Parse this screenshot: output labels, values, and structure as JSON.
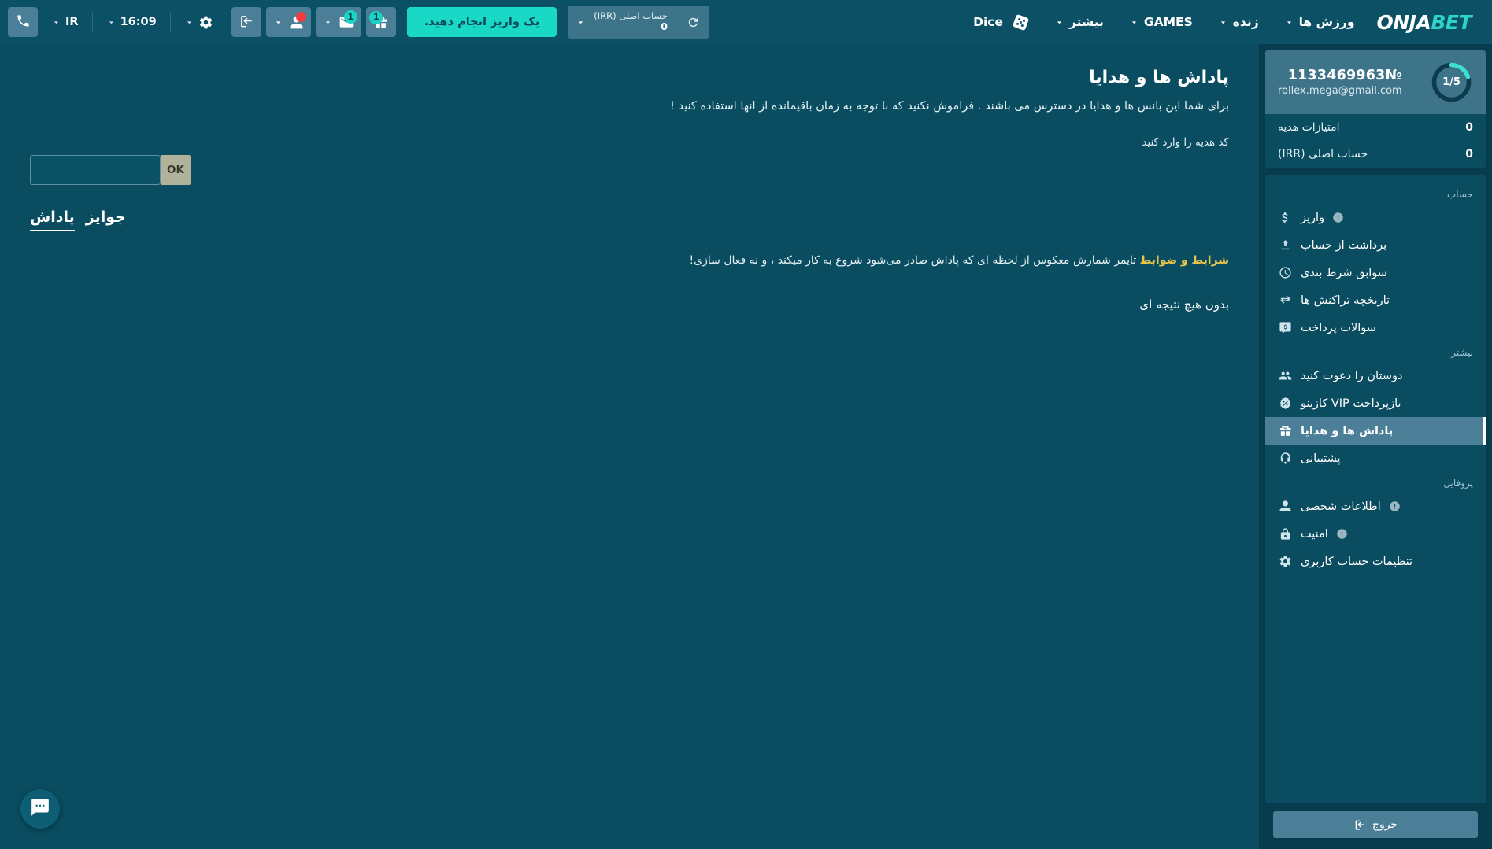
{
  "topbar": {
    "phone_icon": "phone-icon",
    "country": "IR",
    "time": "16:09",
    "settings_icon": "gear-icon",
    "login_icon": "login-arrow-icon",
    "profile_icon": "user-icon",
    "profile_badge": "",
    "mail_icon": "envelope-icon",
    "mail_badge": "1",
    "gift_icon": "gift-icon",
    "gift_badge": "1",
    "deposit_label": "یک واریز انجام دهید.",
    "balance_name": "حساب اصلی (IRR)",
    "balance_amount": "0",
    "refresh_icon": "refresh-icon",
    "dice_label": "Dice",
    "dice_icon": "dice-icon",
    "nav": [
      {
        "label": "بیشتر",
        "icon": "chevron-down-icon"
      },
      {
        "label": "GAMES",
        "icon": "chevron-down-icon"
      },
      {
        "label": "زنده",
        "icon": "chevron-down-icon"
      },
      {
        "label": "ورزش ها",
        "icon": "chevron-down-icon"
      }
    ],
    "logo_primary": "ONJA",
    "logo_accent": "BET"
  },
  "main": {
    "title": "پاداش ها و هدایا",
    "subtitle": "برای شما این بانس ها و هدایا در دسترس می باشند . فراموش نکنید که با توجه به زمان باقیمانده از انها استفاده کنید !",
    "promo_label": "کد هدیه را وارد کنید",
    "promo_value": "",
    "promo_placeholder": "",
    "promo_ok_label": "OK",
    "tabs": [
      {
        "label": "پاداش",
        "active": true
      },
      {
        "label": "جوایز",
        "active": false
      }
    ],
    "notice_text": "تایمر شمارش معکوس از لحظه ای که پاداش صادر می‌شود شروع به کار میکند ، و نه فعال سازی!",
    "notice_link": "شرایط و ضوابط",
    "empty_message": "بدون هیچ نتیجه ای"
  },
  "sidebar": {
    "account": {
      "id": "№1133469963",
      "email": "rollex.mega@gmail.com",
      "progress_label": "1/5",
      "progress_value": 20,
      "rows": [
        {
          "label": "امتیازات هدیه",
          "value": "0"
        },
        {
          "label": "حساب اصلی (IRR)",
          "value": "0"
        }
      ]
    },
    "groups": [
      {
        "heading": "حساب",
        "items": [
          {
            "label": "واریز",
            "icon": "dollar-icon",
            "warn": true,
            "active": false
          },
          {
            "label": "برداشت از حساب",
            "icon": "withdraw-upload-icon",
            "warn": false,
            "active": false
          },
          {
            "label": "سوابق شرط بندی",
            "icon": "clock-icon",
            "warn": false,
            "active": false
          },
          {
            "label": "تاریخچه تراکنش ها",
            "icon": "transfer-arrows-icon",
            "warn": false,
            "active": false
          },
          {
            "label": "سوالات پرداخت",
            "icon": "payment-chat-icon",
            "warn": false,
            "active": false
          }
        ]
      },
      {
        "heading": "بیشتر",
        "items": [
          {
            "label": "دوستان را دعوت کنید",
            "icon": "users-icon",
            "warn": false,
            "active": false
          },
          {
            "label": "بازپرداخت VIP کازینو",
            "icon": "percent-badge-icon",
            "warn": false,
            "active": false
          },
          {
            "label": "پاداش ها و هدایا",
            "icon": "gift-icon",
            "warn": false,
            "active": true
          },
          {
            "label": "پشتیبانی",
            "icon": "support-agent-icon",
            "warn": false,
            "active": false
          }
        ]
      },
      {
        "heading": "پروفایل",
        "items": [
          {
            "label": "اطلاعات شخصی",
            "icon": "person-icon",
            "warn": true,
            "active": false
          },
          {
            "label": "امنیت",
            "icon": "lock-icon",
            "warn": true,
            "active": false
          },
          {
            "label": "تنظیمات حساب کاربری",
            "icon": "gear-icon",
            "warn": false,
            "active": false
          }
        ]
      }
    ],
    "logout_label": "خروج",
    "logout_icon": "logout-icon"
  },
  "chat": {
    "icon": "chat-bubble-icon"
  },
  "colors": {
    "bg": "#0a4c60",
    "sidebar_bg": "#063c4d",
    "panel": "#0b5064",
    "accent_teal": "#19d9c6",
    "button_blue": "#4a7f97",
    "link_gold": "#e8c54a"
  }
}
